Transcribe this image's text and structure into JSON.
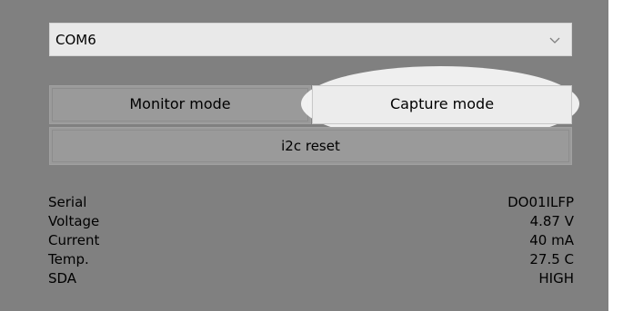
{
  "port_select": {
    "value": "COM6",
    "icon": "chevron-down-icon"
  },
  "modes": {
    "monitor_label": "Monitor mode",
    "capture_label": "Capture mode"
  },
  "reset": {
    "label": "i2c reset"
  },
  "info": [
    {
      "label": "Serial",
      "value": "DO01ILFP"
    },
    {
      "label": "Voltage",
      "value": "4.87 V"
    },
    {
      "label": "Current",
      "value": "40 mA"
    },
    {
      "label": "Temp.",
      "value": "27.5 C"
    },
    {
      "label": "SDA",
      "value": "HIGH"
    }
  ],
  "colors": {
    "panel": "#808080",
    "button": "#9a9a9a",
    "highlight": "#f8f8f8"
  }
}
